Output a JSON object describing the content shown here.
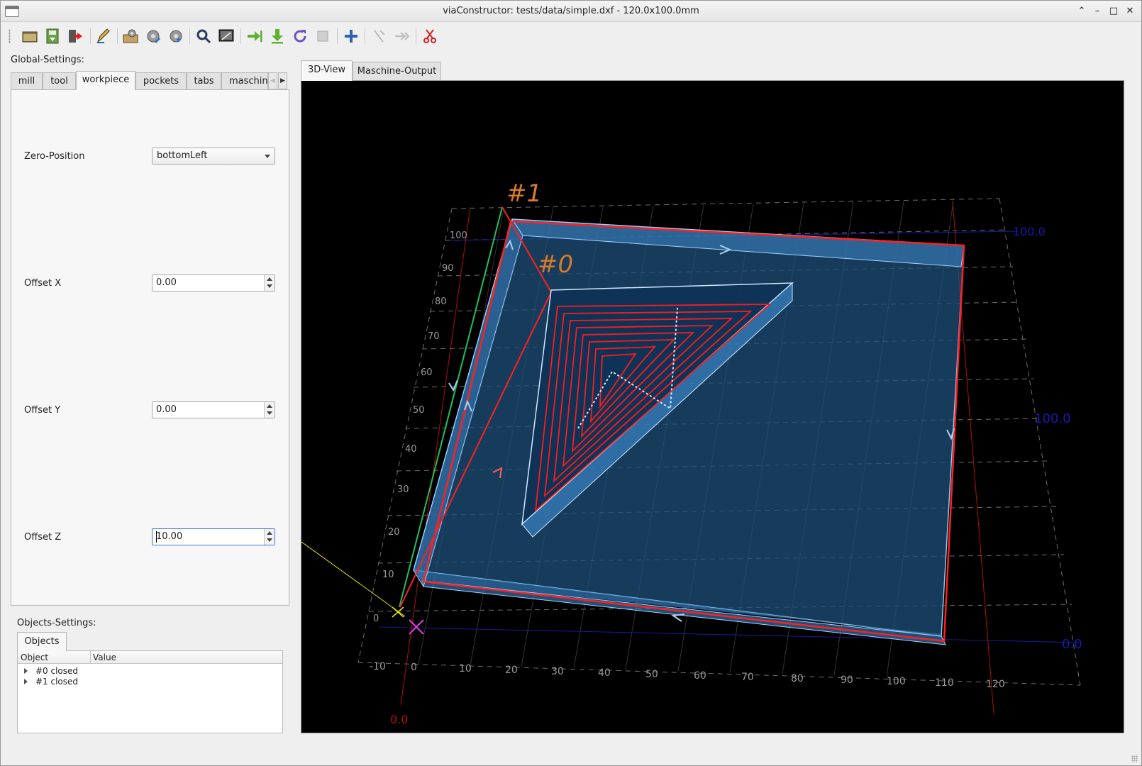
{
  "window": {
    "title": "viaConstructor: tests/data/simple.dxf - 120.0x100.0mm"
  },
  "toolbar": {
    "items": [
      "open-file",
      "save-gcode",
      "exit",
      "draw-tool",
      "load-setup",
      "save-setup",
      "save-default",
      "view-reset",
      "view-2d",
      "export-gcode",
      "download-gcode",
      "redraw",
      "disabled-tool",
      "add-object",
      "disabled-flip",
      "disabled-next",
      "cut-tool"
    ]
  },
  "global": {
    "heading": "Global-Settings:",
    "tabs": [
      "mill",
      "tool",
      "workpiece",
      "pockets",
      "tabs",
      "maschin"
    ],
    "active_tab": "workpiece",
    "zero_position": {
      "label": "Zero-Position",
      "value": "bottomLeft"
    },
    "offset_x": {
      "label": "Offset X",
      "value": "0.00"
    },
    "offset_y": {
      "label": "Offset Y",
      "value": "0.00"
    },
    "offset_z": {
      "label": "Offset Z",
      "value": "10.00"
    }
  },
  "objects": {
    "heading": "Objects-Settings:",
    "tab": "Objects",
    "columns": [
      "Object",
      "Value"
    ],
    "rows": [
      "#0 closed",
      "#1 closed"
    ]
  },
  "view_tabs": [
    "3D-View",
    "Maschine-Output"
  ],
  "viewport": {
    "object_labels": [
      "#1",
      "#0"
    ],
    "scale_labels": [
      "100.0",
      "100.0",
      "0.0",
      "0.0"
    ],
    "x_ticks": [
      "-10",
      "0",
      "10",
      "20",
      "30",
      "40",
      "50",
      "60",
      "70",
      "80",
      "90",
      "100",
      "110",
      "120"
    ],
    "y_ticks": [
      "0",
      "10",
      "20",
      "30",
      "40",
      "50",
      "60",
      "70",
      "80",
      "90",
      "100"
    ],
    "colors": {
      "workpiece": "#1f4f7a",
      "toolpath": "#ff1a1a",
      "object_label": "#d9792a",
      "axis_label": "#1a1ab0",
      "grid": "#777777"
    }
  }
}
